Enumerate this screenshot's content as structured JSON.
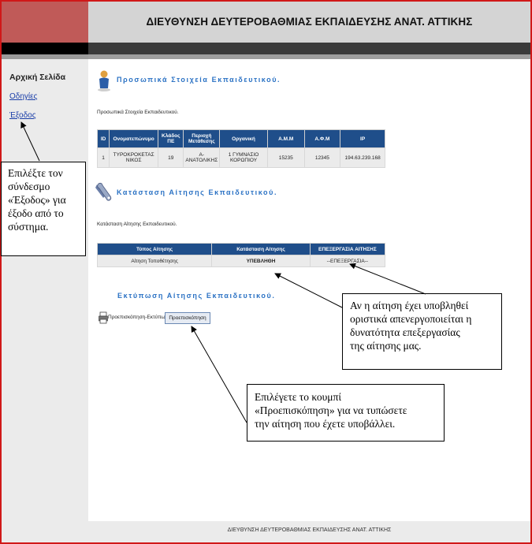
{
  "header": {
    "title": "ΔΙΕΥΘΥΝΣΗ ΔΕΥΤΕΡΟΒΑΘΜΙΑΣ ΕΚΠΑΙΔΕΥΣΗΣ ΑΝΑΤ. ΑΤΤΙΚΗΣ"
  },
  "sidebar": {
    "title": "Αρχική Σελίδα",
    "links": [
      "Οδηγίες",
      "Έξοδος"
    ]
  },
  "personal": {
    "heading": "Προσωπικά Στοιχεία Εκπαιδευτικού.",
    "label": "Προσωπικά Στοιχεία Εκπαιδευτικού.",
    "columns": [
      "ID",
      "Ονοματεπώνυμο",
      "Κλάδος ΠΕ",
      "Περιοχή Μετάθεσης",
      "Οργανική",
      "Α.Μ.Μ",
      "Α.Φ.Μ",
      "IP"
    ],
    "row": [
      "1",
      "ΤΥΡΟΚΡΟΚΕΤΑΣ ΝΙΚΟΣ",
      "19",
      "Α-ΑΝΑΤΟΛΙΚΗΣ",
      "1 ΓΥΜΝΑΣΙΟ ΚΟΡΩΠΙΟΥ",
      "15235",
      "12345",
      "194.63.239.168"
    ]
  },
  "status": {
    "heading": "Κατάσταση Αίτησης Εκπαιδευτικού.",
    "label": "Κατάσταση Αίτησης Εκπαιδευτικού.",
    "columns": [
      "Τύπος Αίτησης",
      "Κατάσταση Αίτησης",
      "ΕΠΕΞΕΡΓΑΣΙΑ ΑΙΤΗΣΗΣ"
    ],
    "row": [
      "Αίτηση Τοποθέτησης",
      "ΥΠΕΒΛΗΘΗ",
      "--ΕΠΕΞΕΡΓΑΣΙΑ--"
    ]
  },
  "print": {
    "heading": "Εκτύπωση Αίτησης Εκπαιδευτικού.",
    "label": "Προεπισκόπηση-Εκτύπωση",
    "button": "Προεπισκόπηση"
  },
  "callouts": {
    "exit": [
      "Επιλέξτε τον",
      "σύνδεσμο",
      "«Έξοδος» για",
      "έξοδο από το",
      "σύστημα."
    ],
    "submitted": [
      "Αν η αίτηση έχει υποβληθεί",
      "οριστικά απενεργοποιείται η",
      "δυνατότητα επεξεργασίας",
      "της αίτησης μας."
    ],
    "preview": [
      "Επιλέγετε το κουμπί",
      "«Προεπισκόπηση» για να τυπώσετε",
      "την αίτηση που έχετε υποβάλλει."
    ]
  },
  "footer": {
    "text": "ΔΙΕΥΘΥΝΣΗ ΔΕΥΤΕΡΟΒΑΘΜΙΑΣ ΕΚΠΑΙΔΕΥΣΗΣ ΑΝΑΤ. ΑΤΤΙΚΗΣ"
  },
  "colors": {
    "header_blue": "#1f4e8a",
    "heading_blue": "#2b72c4",
    "status_red": "#d01010",
    "frame_red": "#d01818"
  }
}
